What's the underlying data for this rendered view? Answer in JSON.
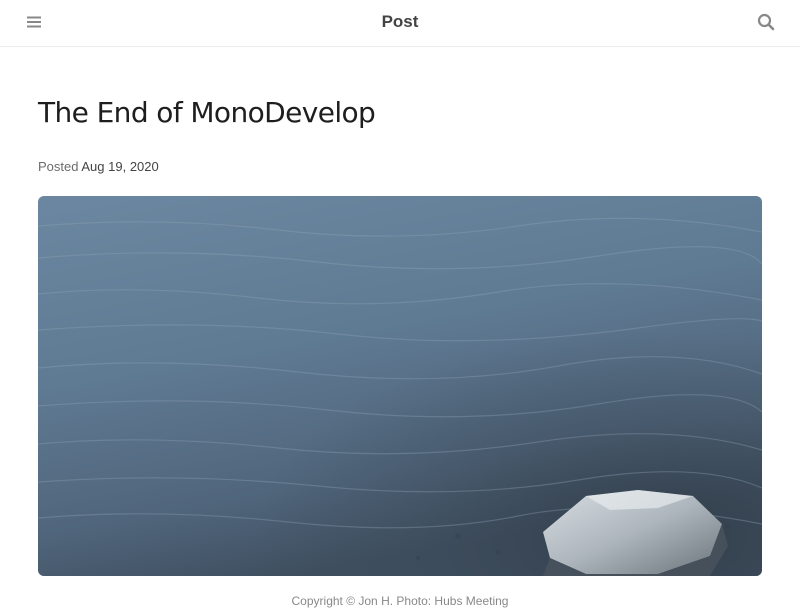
{
  "header": {
    "title": "Post",
    "menu_icon": "hamburger-menu-icon",
    "search_icon": "search-icon"
  },
  "post": {
    "title": "The End of MonoDevelop",
    "posted_label": "Posted",
    "date": "Aug 19, 2020",
    "image_caption": "Copyright © Jon H. Photo: Hubs Meeting"
  },
  "colors": {
    "header_text": "#444444",
    "title_text": "#1e1e1e",
    "meta_text": "#6c6c6c",
    "divider": "#ececec",
    "icon": "#888888"
  }
}
